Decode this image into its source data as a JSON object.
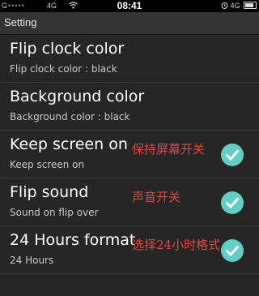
{
  "status_bar": {
    "carrier_signal": "G",
    "network_type": "4G",
    "time": "08:41",
    "right_network": "4G"
  },
  "header": {
    "title": "Setting"
  },
  "settings": [
    {
      "title": "Flip clock color",
      "summary": "Flip clock color : black",
      "note": "",
      "checked": false
    },
    {
      "title": "Background color",
      "summary": "Background color : black",
      "note": "",
      "checked": false
    },
    {
      "title": "Keep screen on",
      "summary": "Keep screen on",
      "note": "保持屏幕开关",
      "checked": true
    },
    {
      "title": "Flip sound",
      "summary": "Sound on flip over",
      "note": "声音开关",
      "checked": true
    },
    {
      "title": "24 Hours format",
      "summary": "24 Hours",
      "note": "选择24小时格式",
      "checked": true
    }
  ],
  "colors": {
    "check_color": "#63cfc4",
    "note_color": "#e7463a",
    "background": "#262626"
  },
  "icons": {
    "status_alarm": "alarm-icon",
    "status_wifi": "wifi-icon",
    "battery": "battery-icon",
    "check": "checkmark-icon"
  }
}
